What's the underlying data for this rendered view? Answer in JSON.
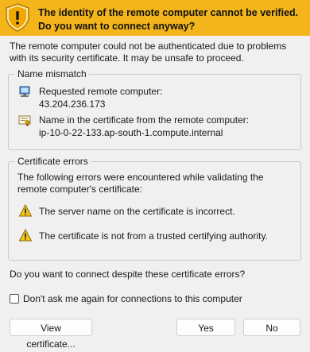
{
  "header": {
    "title": "The identity of the remote computer cannot be verified. Do you want to connect anyway?",
    "icon": "warning-shield-icon",
    "background_color": "#f3b51b"
  },
  "intro_text": "The remote computer could not be authenticated due to problems with its security certificate. It may be unsafe to proceed.",
  "name_mismatch": {
    "legend": "Name mismatch",
    "requested_label": "Requested remote computer:",
    "requested_value": "43.204.236.173",
    "certificate_label": "Name in the certificate from the remote computer:",
    "certificate_value": "ip-10-0-22-133.ap-south-1.compute.internal"
  },
  "certificate_errors": {
    "legend": "Certificate errors",
    "description": "The following errors were encountered while validating the remote computer's certificate:",
    "errors": [
      "The server name on the certificate is incorrect.",
      "The certificate is not from a trusted certifying authority."
    ]
  },
  "question": "Do you want to connect despite these certificate errors?",
  "dont_ask_checkbox": {
    "label": "Don't ask me again for connections to this computer",
    "checked": false
  },
  "buttons": {
    "view_certificate": "View certificate...",
    "yes": "Yes",
    "no": "No"
  }
}
